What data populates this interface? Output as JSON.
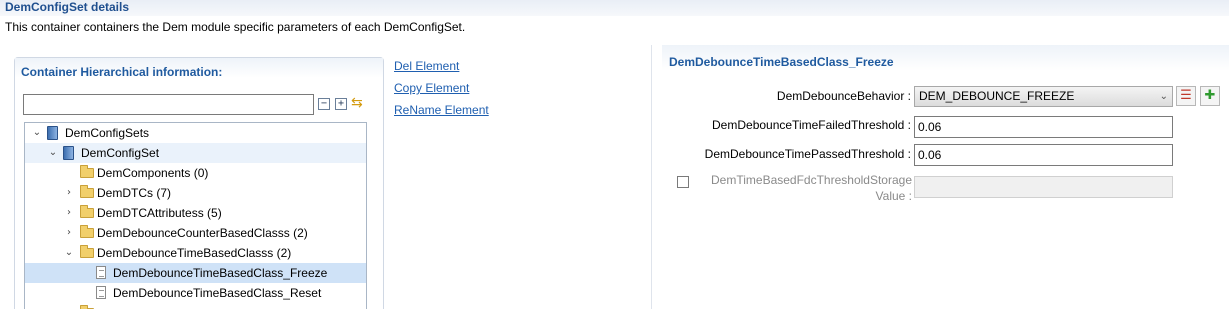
{
  "page": {
    "title": "DemConfigSet details",
    "description": "This container containers the Dem module specific parameters of each DemConfigSet."
  },
  "left_panel": {
    "title": "Container Hierarchical information:",
    "filter_value": "",
    "collapse_all_symbol": "−",
    "expand_all_symbol": "+",
    "sync_icon_glyph": "⇆",
    "tree": [
      {
        "label": "DemConfigSets",
        "icon": "db-icon",
        "expanded": true
      },
      {
        "label": "DemConfigSet",
        "icon": "db-icon",
        "expanded": true
      },
      {
        "label": "DemComponents (0)",
        "icon": "folder-icon"
      },
      {
        "label": "DemDTCs (7)",
        "icon": "folder-icon",
        "expanded": false
      },
      {
        "label": "DemDTCAttributess (5)",
        "icon": "folder-icon",
        "expanded": false
      },
      {
        "label": "DemDebounceCounterBasedClasss (2)",
        "icon": "folder-icon",
        "expanded": false
      },
      {
        "label": "DemDebounceTimeBasedClasss (2)",
        "icon": "folder-icon",
        "expanded": true
      },
      {
        "label": "DemDebounceTimeBasedClass_Freeze",
        "icon": "document-icon",
        "selected": true
      },
      {
        "label": "DemDebounceTimeBasedClass_Reset",
        "icon": "document-icon"
      }
    ]
  },
  "actions": {
    "del": "Del Element",
    "copy": "Copy Element",
    "rename": "ReName Element"
  },
  "right_panel": {
    "title": "DemDebounceTimeBasedClass_Freeze",
    "fields": {
      "behavior_label": "DemDebounceBehavior :",
      "behavior_value": "DEM_DEBOUNCE_FREEZE",
      "failed_label": "DemDebounceTimeFailedThreshold :",
      "failed_value": "0.06",
      "passed_label": "DemDebounceTimePassedThreshold :",
      "passed_value": "0.06",
      "storage_label_line1": "DemTimeBasedFdcThresholdStorage",
      "storage_label_line2": "Value :",
      "storage_checked": false
    },
    "list_button_glyph": "☰",
    "add_button_glyph": "✚"
  },
  "colors": {
    "title_blue": "#1f4f8f",
    "link_blue": "#1f5fb0",
    "selection": "#cfe2f7",
    "add_green": "#2f9a2f",
    "list_red": "#c0392b"
  }
}
